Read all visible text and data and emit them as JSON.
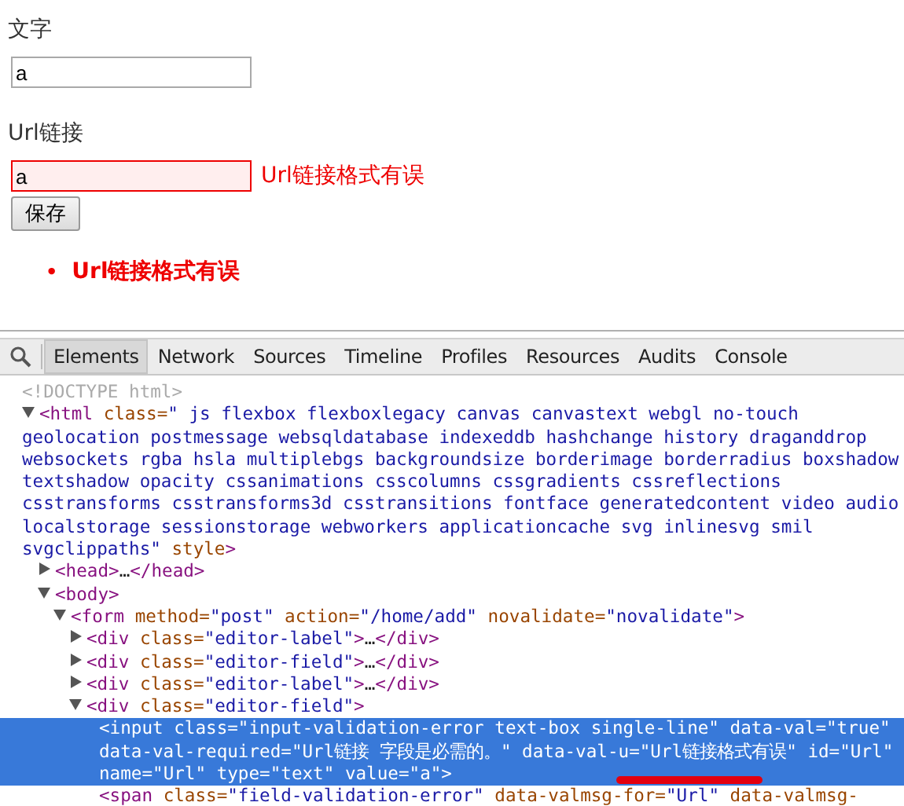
{
  "form": {
    "fields": [
      {
        "label": "文字",
        "value": "a",
        "invalid": false
      },
      {
        "label": "Url链接",
        "value": "a",
        "invalid": true,
        "error": "Url链接格式有误"
      }
    ],
    "submit": "保存",
    "summary": [
      {
        "bullet": "•",
        "text": "Url链接格式有误"
      }
    ]
  },
  "devtools": {
    "tabs": [
      {
        "label": "Elements",
        "selected": true
      },
      {
        "label": "Network",
        "selected": false
      },
      {
        "label": "Sources",
        "selected": false
      },
      {
        "label": "Timeline",
        "selected": false
      },
      {
        "label": "Profiles",
        "selected": false
      },
      {
        "label": "Resources",
        "selected": false
      },
      {
        "label": "Audits",
        "selected": false
      },
      {
        "label": "Console",
        "selected": false
      }
    ],
    "doctype": "<!DOCTYPE html>",
    "tree": [
      {
        "expanded": true,
        "selected": false,
        "parts": [
          {
            "kind": "tag",
            "text": "<html"
          },
          {
            "kind": "attr",
            "text": " class="
          },
          {
            "kind": "value",
            "text": "\" js flexbox flexboxlegacy canvas canvastext webgl no-touch geolocation postmessage websqldatabase indexeddb hashchange history draganddrop websockets rgba hsla multiplebgs backgroundsize borderimage borderradius boxshadow textshadow opacity cssanimations csscolumns cssgradients cssreflections csstransforms csstransforms3d csstransitions fontface generatedcontent video audio localstorage sessionstorage webworkers applicationcache svg inlinesvg smil svgclippaths\""
          },
          {
            "kind": "attr",
            "text": " style"
          },
          {
            "kind": "tag",
            "text": ">"
          }
        ],
        "children": [
          {
            "expanded": false,
            "selected": false,
            "parts": [
              {
                "kind": "tag",
                "text": "<head>"
              },
              {
                "kind": "text",
                "text": "…"
              },
              {
                "kind": "tag",
                "text": "</head>"
              }
            ]
          },
          {
            "expanded": true,
            "selected": false,
            "parts": [
              {
                "kind": "tag",
                "text": "<body>"
              }
            ],
            "children": [
              {
                "expanded": true,
                "selected": false,
                "parts": [
                  {
                    "kind": "tag",
                    "text": "<form"
                  },
                  {
                    "kind": "attr",
                    "text": " method="
                  },
                  {
                    "kind": "value",
                    "text": "\"post\""
                  },
                  {
                    "kind": "attr",
                    "text": " action="
                  },
                  {
                    "kind": "value",
                    "text": "\"/home/add\""
                  },
                  {
                    "kind": "attr",
                    "text": " novalidate="
                  },
                  {
                    "kind": "value",
                    "text": "\"novalidate\""
                  },
                  {
                    "kind": "tag",
                    "text": ">"
                  }
                ],
                "children": [
                  {
                    "expanded": false,
                    "selected": false,
                    "parts": [
                      {
                        "kind": "tag",
                        "text": "<div"
                      },
                      {
                        "kind": "attr",
                        "text": " class="
                      },
                      {
                        "kind": "value",
                        "text": "\"editor-label\""
                      },
                      {
                        "kind": "tag",
                        "text": ">"
                      },
                      {
                        "kind": "text",
                        "text": "…"
                      },
                      {
                        "kind": "tag",
                        "text": "</div>"
                      }
                    ]
                  },
                  {
                    "expanded": false,
                    "selected": false,
                    "parts": [
                      {
                        "kind": "tag",
                        "text": "<div"
                      },
                      {
                        "kind": "attr",
                        "text": " class="
                      },
                      {
                        "kind": "value",
                        "text": "\"editor-field\""
                      },
                      {
                        "kind": "tag",
                        "text": ">"
                      },
                      {
                        "kind": "text",
                        "text": "…"
                      },
                      {
                        "kind": "tag",
                        "text": "</div>"
                      }
                    ]
                  },
                  {
                    "expanded": false,
                    "selected": false,
                    "parts": [
                      {
                        "kind": "tag",
                        "text": "<div"
                      },
                      {
                        "kind": "attr",
                        "text": " class="
                      },
                      {
                        "kind": "value",
                        "text": "\"editor-label\""
                      },
                      {
                        "kind": "tag",
                        "text": ">"
                      },
                      {
                        "kind": "text",
                        "text": "…"
                      },
                      {
                        "kind": "tag",
                        "text": "</div>"
                      }
                    ]
                  },
                  {
                    "expanded": true,
                    "selected": false,
                    "parts": [
                      {
                        "kind": "tag",
                        "text": "<div"
                      },
                      {
                        "kind": "attr",
                        "text": " class="
                      },
                      {
                        "kind": "value",
                        "text": "\"editor-field\""
                      },
                      {
                        "kind": "tag",
                        "text": ">"
                      }
                    ],
                    "children": [
                      {
                        "selected": true,
                        "underlined": true,
                        "parts": [
                          {
                            "kind": "tag",
                            "text": "<input"
                          },
                          {
                            "kind": "attr",
                            "text": " class="
                          },
                          {
                            "kind": "value",
                            "text": "\"input-validation-error text-box single-line\""
                          },
                          {
                            "kind": "attr",
                            "text": " data-val="
                          },
                          {
                            "kind": "value",
                            "text": "\"true\""
                          },
                          {
                            "kind": "attr",
                            "text": " data-val-required="
                          },
                          {
                            "kind": "value",
                            "text": "\"Url链接 字段是必需的。\""
                          },
                          {
                            "kind": "attr",
                            "text": " data-val-u="
                          },
                          {
                            "kind": "value",
                            "text": "\"Url链接格式有误\""
                          },
                          {
                            "kind": "attr",
                            "text": " id="
                          },
                          {
                            "kind": "value",
                            "text": "\"Url\""
                          },
                          {
                            "kind": "attr",
                            "text": " name="
                          },
                          {
                            "kind": "value",
                            "text": "\"Url\""
                          },
                          {
                            "kind": "attr",
                            "text": " type="
                          },
                          {
                            "kind": "value",
                            "text": "\"text\""
                          },
                          {
                            "kind": "attr",
                            "text": " value="
                          },
                          {
                            "kind": "value",
                            "text": "\"a\""
                          },
                          {
                            "kind": "tag",
                            "text": ">"
                          }
                        ]
                      },
                      {
                        "selected": false,
                        "parts": [
                          {
                            "kind": "tag",
                            "text": "<span"
                          },
                          {
                            "kind": "attr",
                            "text": " class="
                          },
                          {
                            "kind": "value",
                            "text": "\"field-validation-error\""
                          },
                          {
                            "kind": "attr",
                            "text": " data-valmsg-for="
                          },
                          {
                            "kind": "value",
                            "text": "\"Url\""
                          },
                          {
                            "kind": "attr",
                            "text": " data-valmsg-"
                          }
                        ]
                      }
                    ]
                  }
                ]
              }
            ]
          }
        ]
      }
    ]
  }
}
